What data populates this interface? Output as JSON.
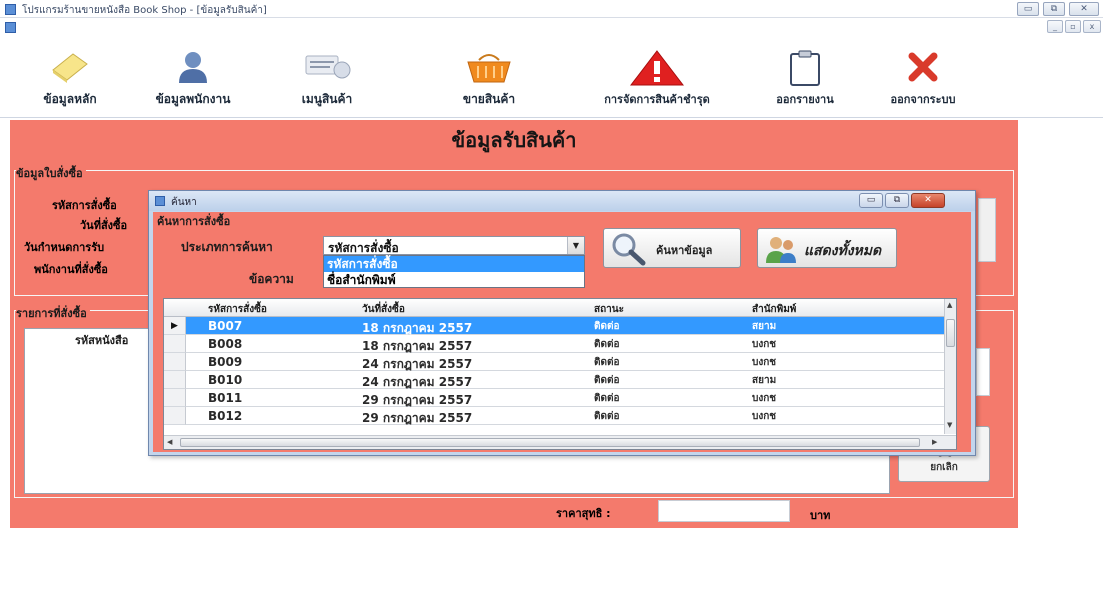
{
  "window": {
    "title": "โปรแกรมร้านขายหนังสือ Book Shop - [ข้อมูลรับสินค้า]",
    "controls": {
      "minimize": "▭",
      "restore": "⧉",
      "close": "✕"
    },
    "mdi_controls": {
      "minimize": "_",
      "restore": "▫",
      "close": "x"
    }
  },
  "toolbar": {
    "items": [
      {
        "label": "ข้อมูลหลัก",
        "icon": "note-icon"
      },
      {
        "label": "ข้อมูลพนักงาน",
        "icon": "user-icon"
      },
      {
        "label": "เมนูสินค้า",
        "icon": "stamp-icon"
      },
      {
        "label": "ขายสินค้า",
        "icon": "basket-icon"
      },
      {
        "label": "การจัดการสินค้าชำรุด",
        "icon": "warning-icon"
      },
      {
        "label": "ออกรายงาน",
        "icon": "clipboard-icon"
      },
      {
        "label": "ออกจากระบบ",
        "icon": "exit-icon"
      }
    ]
  },
  "form": {
    "title": "ข้อมูลรับสินค้า",
    "order_group": "ข้อมูลใบสั่งซื้อ",
    "fields": {
      "order_id": "รหัสการสั่งซื้อ",
      "order_date": "วันที่สั่งซื้อ",
      "due_date": "วันกำหนดการรับ",
      "employee": "พนักงานที่สั่งซื้อ"
    },
    "items_group": "รายการที่สั่งซื้อ",
    "items_col_book_id": "รหัสหนังสือ",
    "cancel_label": "ยกเลิก",
    "net_price_label": "ราคาสุทธิ :",
    "currency": "บาท"
  },
  "dialog": {
    "title": "ค้นหา",
    "group_label": "ค้นหาการสั่งซื้อ",
    "search_type_label": "ประเภทการค้นหา",
    "message_label": "ข้อความ",
    "combo_value": "รหัสการสั่งซื้อ",
    "dropdown_options": [
      "รหัสการสั่งซื้อ",
      "ชื่อสำนักพิมพ์"
    ],
    "search_button": "ค้นหาข้อมูล",
    "show_all_button": "แสดงทั้งหมด",
    "grid": {
      "columns": [
        "รหัสการสั่งซื้อ",
        "วันที่สั่งซื้อ",
        "สถานะ",
        "สำนักพิมพ์"
      ],
      "rows": [
        {
          "id": "B007",
          "date": "18 กรกฎาคม 2557",
          "status": "ติดต่อ",
          "publisher": "สยาม",
          "selected": true
        },
        {
          "id": "B008",
          "date": "18 กรกฎาคม 2557",
          "status": "ติดต่อ",
          "publisher": "บงกช",
          "selected": false
        },
        {
          "id": "B009",
          "date": "24 กรกฎาคม 2557",
          "status": "ติดต่อ",
          "publisher": "บงกช",
          "selected": false
        },
        {
          "id": "B010",
          "date": "24 กรกฎาคม 2557",
          "status": "ติดต่อ",
          "publisher": "สยาม",
          "selected": false
        },
        {
          "id": "B011",
          "date": "29 กรกฎาคม 2557",
          "status": "ติดต่อ",
          "publisher": "บงกช",
          "selected": false
        },
        {
          "id": "B012",
          "date": "29 กรกฎาคม 2557",
          "status": "ติดต่อ",
          "publisher": "บงกช",
          "selected": false
        }
      ],
      "current_row_marker": "▶"
    }
  },
  "colors": {
    "form_background": "#f47a6c",
    "selection": "#3399ff"
  }
}
